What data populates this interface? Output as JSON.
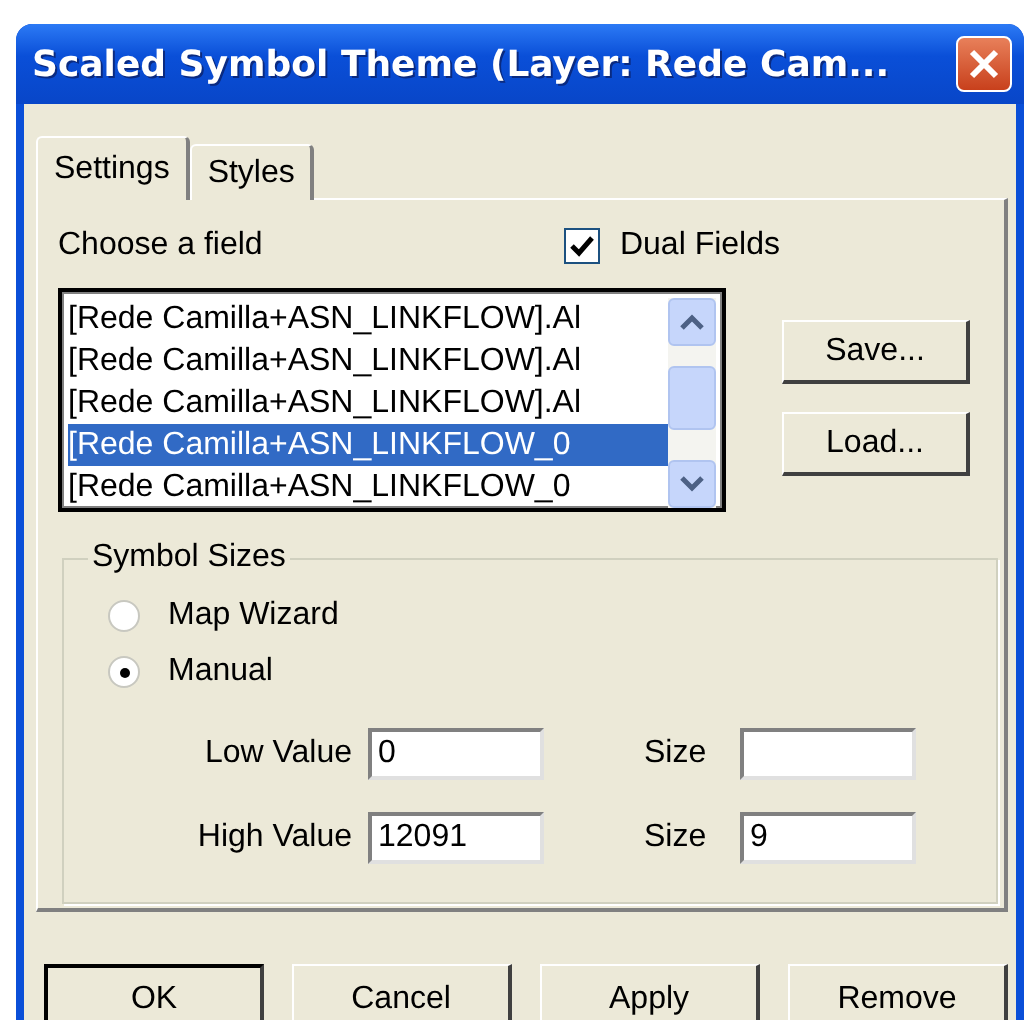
{
  "window": {
    "title": "Scaled Symbol Theme (Layer: Rede Cam..."
  },
  "tabs": [
    {
      "label": "Settings",
      "selected": true
    },
    {
      "label": "Styles",
      "selected": false
    }
  ],
  "field_chooser": {
    "label": "Choose a field",
    "dual_fields": {
      "label": "Dual Fields",
      "checked": true
    },
    "items": [
      {
        "text": "[Rede Camilla+ASN_LINKFLOW].Al",
        "selected": false
      },
      {
        "text": "[Rede Camilla+ASN_LINKFLOW].Al",
        "selected": false
      },
      {
        "text": "[Rede Camilla+ASN_LINKFLOW].Al",
        "selected": false
      },
      {
        "text": "[Rede Camilla+ASN_LINKFLOW_0",
        "selected": true
      },
      {
        "text": "[Rede Camilla+ASN_LINKFLOW_0",
        "selected": false
      }
    ],
    "buttons": [
      "Save...",
      "Load..."
    ]
  },
  "symbol_sizes": {
    "title": "Symbol Sizes",
    "options": [
      {
        "label": "Map Wizard",
        "selected": false
      },
      {
        "label": "Manual",
        "selected": true
      }
    ],
    "rows": [
      {
        "label": "Low Value",
        "value": "0",
        "size_label": "Size",
        "size": ""
      },
      {
        "label": "High Value",
        "value": "12091",
        "size_label": "Size",
        "size": "9"
      }
    ]
  },
  "buttons": [
    {
      "label": "OK",
      "default": true
    },
    {
      "label": "Cancel",
      "default": false
    },
    {
      "label": "Apply",
      "default": false
    },
    {
      "label": "Remove",
      "default": false
    }
  ]
}
